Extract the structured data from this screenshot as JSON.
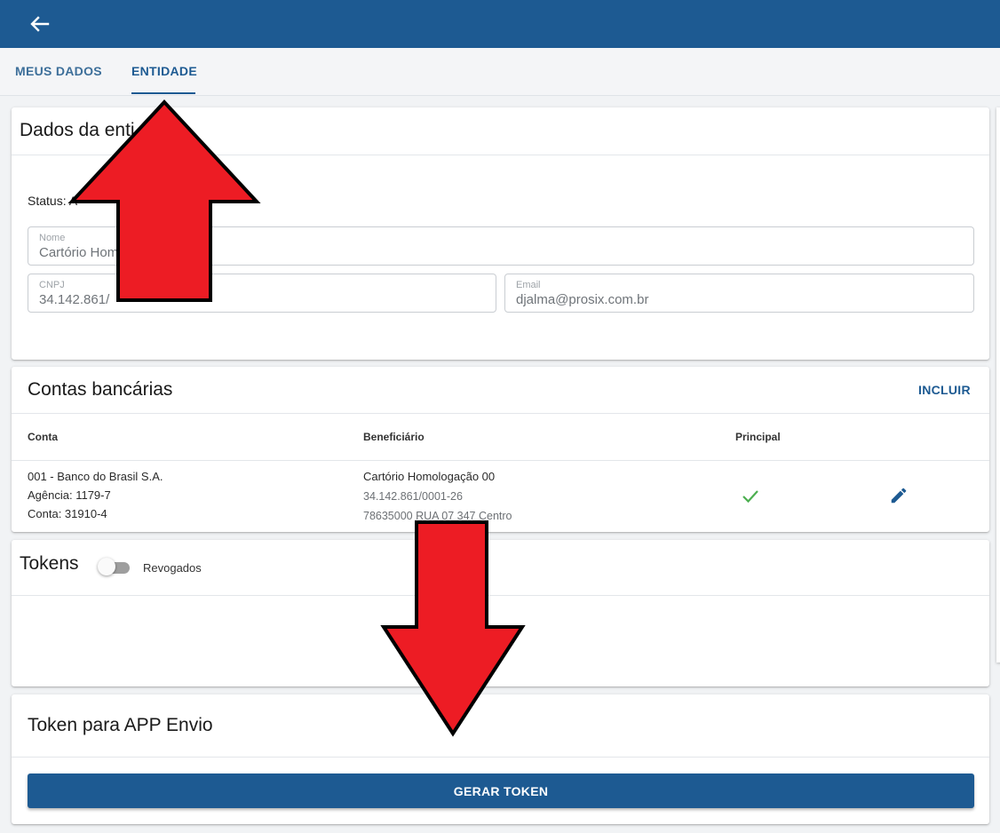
{
  "header": {
    "back_icon": "arrow-left-icon"
  },
  "tabs": [
    {
      "label": "MEUS DADOS"
    },
    {
      "label": "ENTIDADE"
    }
  ],
  "entity": {
    "title": "Dados da enti",
    "status_label": "Status: A",
    "nome": {
      "label": "Nome",
      "value": "Cartório Hom"
    },
    "cnpj": {
      "label": "CNPJ",
      "value": "34.142.861/"
    },
    "email": {
      "label": "Email",
      "value": "djalma@prosix.com.br"
    }
  },
  "bank": {
    "title": "Contas bancárias",
    "add_label": "INCLUIR",
    "columns": [
      "Conta",
      "Beneficiário",
      "Principal"
    ],
    "rows": [
      {
        "account_lines": [
          "001 - Banco do Brasil S.A.",
          "Agência: 1179-7",
          "Conta: 31910-4"
        ],
        "beneficiary_name": "Cartório Homologação 00",
        "beneficiary_cnpj": "34.142.861/0001-26",
        "beneficiary_address": "78635000 RUA 07 347 Centro",
        "principal_icon": "check-icon",
        "edit_icon": "pencil-icon"
      }
    ]
  },
  "tokens": {
    "title": "Tokens",
    "toggle_label": "Revogados",
    "toggle_on": false
  },
  "app_token": {
    "title": "Token para APP Envio",
    "button_label": "GERAR TOKEN"
  },
  "colors": {
    "primary": "#1d5a92",
    "check": "#4caf50",
    "arrow": "#ed1c24"
  }
}
